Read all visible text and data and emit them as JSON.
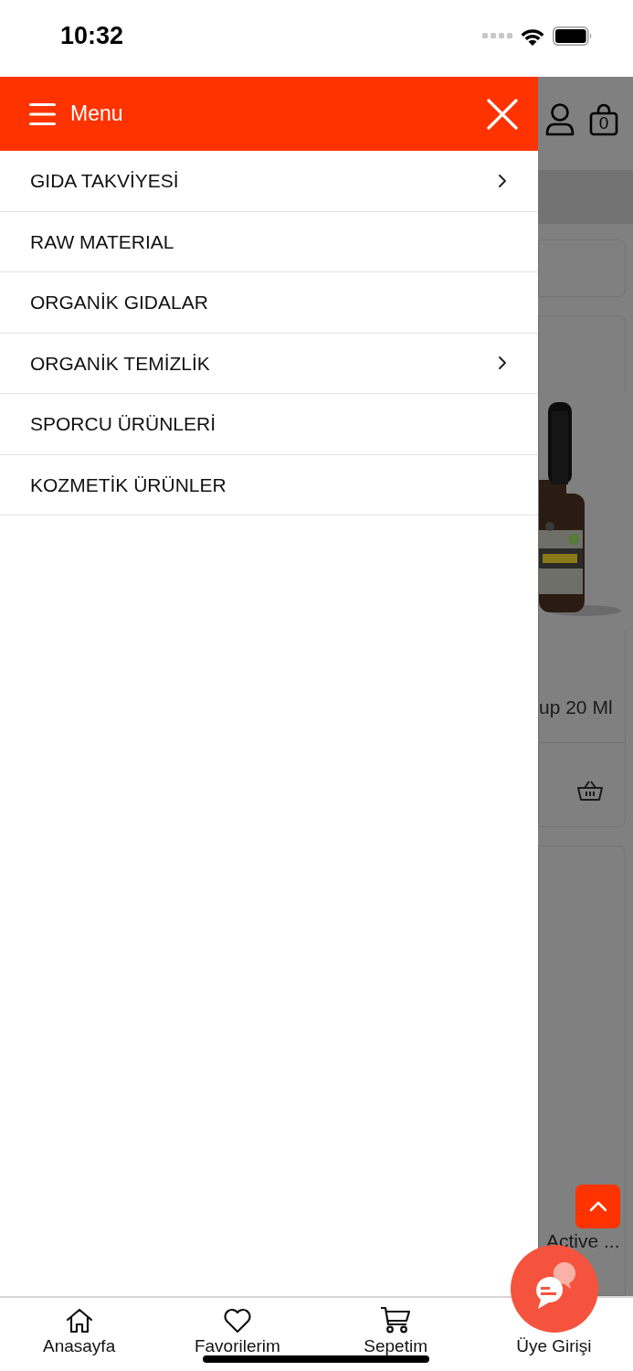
{
  "status_bar": {
    "time": "10:32"
  },
  "drawer": {
    "title": "Menu",
    "items": [
      {
        "label": "GIDA TAKVİYESİ",
        "has_children": true
      },
      {
        "label": "RAW MATERIAL",
        "has_children": false
      },
      {
        "label": "ORGANİK GIDALAR",
        "has_children": false
      },
      {
        "label": "ORGANİK TEMİZLİK",
        "has_children": true
      },
      {
        "label": "SPORCU ÜRÜNLERİ",
        "has_children": false
      },
      {
        "label": "KOZMETİK ÜRÜNLER",
        "has_children": false
      }
    ]
  },
  "background_page": {
    "cart_count": "0",
    "products": [
      {
        "name": "up 20 Ml"
      },
      {
        "name": "Active ..."
      }
    ]
  },
  "bottom_nav": [
    {
      "label": "Anasayfa"
    },
    {
      "label": "Favorilerim"
    },
    {
      "label": "Sepetim"
    },
    {
      "label": "Üye Girişi"
    }
  ]
}
